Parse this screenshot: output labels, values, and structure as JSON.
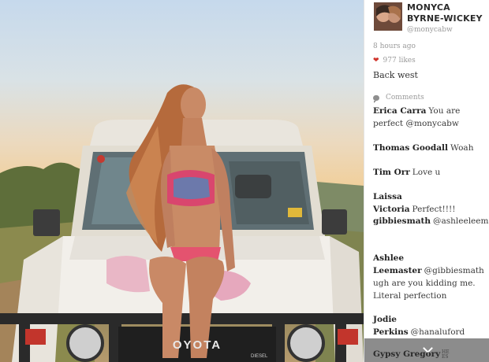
{
  "post": {
    "user_name": "MONYCA BYRNE-WICKEY",
    "user_handle": "@monycabw",
    "time_ago": "8 hours ago",
    "likes": "977 likes",
    "caption": "Back west",
    "comments_label": "Comments"
  },
  "comments": [
    {
      "author": "Erica Carra",
      "text": "You are perfect @monycabw"
    },
    {
      "author": "Thomas Goodall",
      "text": "Woah"
    },
    {
      "author": "Tim Orr",
      "text": "Love u"
    },
    {
      "author": "Laissa Victoria",
      "text": "Perfect!!!!"
    },
    {
      "author": "gibbiesmath",
      "text": "@ashleeleemaster"
    },
    {
      "author": "Ashlee Leemaster",
      "text": "@gibbiesmath ugh are you kidding me. Literal perfection"
    },
    {
      "author": "Jodie Perkins",
      "text": "@hanaluford"
    },
    {
      "author": "Gypsy Gregory",
      "text": "HE ES"
    }
  ],
  "photo": {
    "grille_text": "OYOTA",
    "badge_text": "DIESEL"
  },
  "colors": {
    "heart": "#d0342c",
    "bottom_bar": "#8c8c8c"
  },
  "icons": [
    "heart-icon",
    "comment-icon",
    "chevron-down-icon"
  ]
}
